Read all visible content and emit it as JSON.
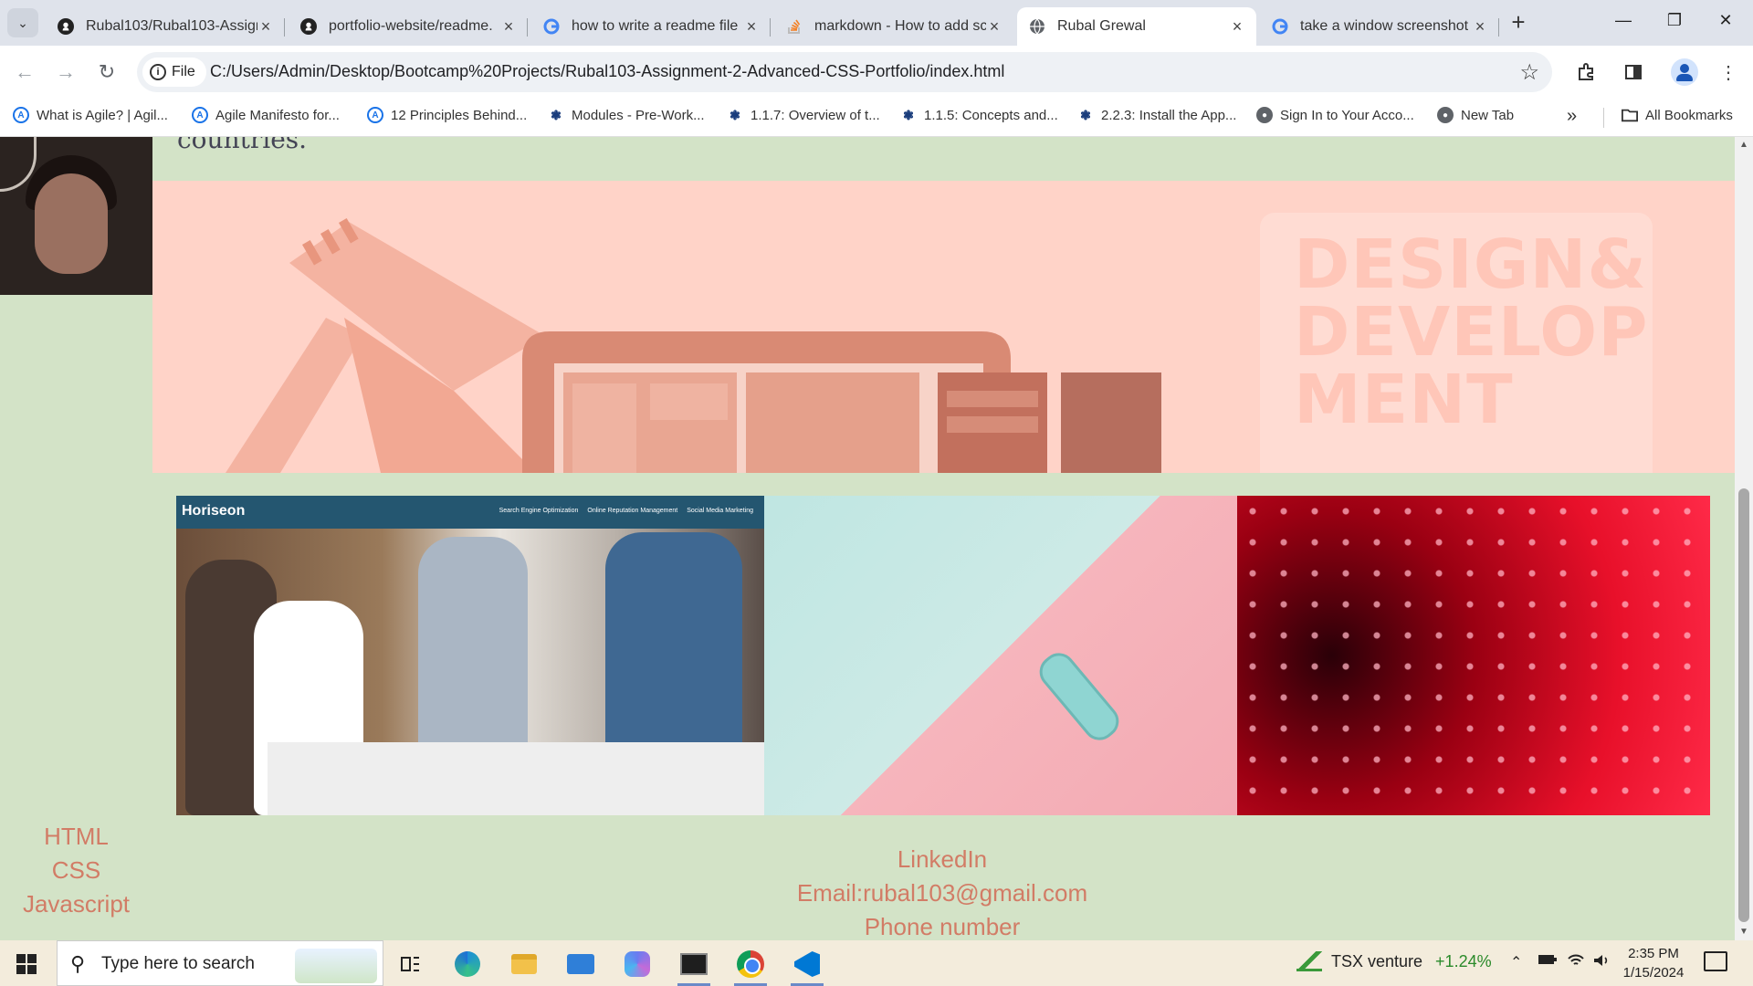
{
  "browser": {
    "tabs": [
      {
        "title": "Rubal103/Rubal103-Assign",
        "icon": "github-icon",
        "active": false
      },
      {
        "title": "portfolio-website/readme.",
        "icon": "github-icon",
        "active": false
      },
      {
        "title": "how to write a readme file",
        "icon": "google-icon",
        "active": false
      },
      {
        "title": "markdown - How to add sc",
        "icon": "stackoverflow-icon",
        "active": false
      },
      {
        "title": "Rubal Grewal",
        "icon": "globe-icon",
        "active": true
      },
      {
        "title": "take a window screenshot",
        "icon": "google-icon",
        "active": false
      }
    ],
    "address": {
      "scheme_label": "File",
      "url": "C:/Users/Admin/Desktop/Bootcamp%20Projects/Rubal103-Assignment-2-Advanced-CSS-Portfolio/index.html"
    },
    "bookmarks": [
      {
        "label": "What is Agile? | Agil...",
        "icon": "agile-icon"
      },
      {
        "label": "Agile Manifesto for...",
        "icon": "agile-icon"
      },
      {
        "label": "12 Principles Behind...",
        "icon": "agile-icon"
      },
      {
        "label": "Modules - Pre-Work...",
        "icon": "canvas-icon"
      },
      {
        "label": "1.1.7: Overview of t...",
        "icon": "canvas-icon"
      },
      {
        "label": "1.1.5: Concepts and...",
        "icon": "canvas-icon"
      },
      {
        "label": "2.2.3: Install the App...",
        "icon": "canvas-icon"
      },
      {
        "label": "Sign In to Your Acco...",
        "icon": "globe-icon"
      },
      {
        "label": "New Tab",
        "icon": "globe-icon"
      }
    ],
    "all_bookmarks_label": "All Bookmarks"
  },
  "page": {
    "intro_tail": "countries.",
    "hero_text_lines": [
      "DESIGN&",
      "DEVELOP",
      "MENT"
    ],
    "gallery": [
      {
        "brand": "Horiseon",
        "menu": [
          "Search Engine Optimization",
          "Online Reputation Management",
          "Social Media Marketing"
        ]
      }
    ],
    "skills": [
      "HTML",
      "CSS",
      "Javascript"
    ],
    "contact": [
      "LinkedIn",
      "Email:rubal103@gmail.com",
      "Phone number"
    ]
  },
  "taskbar": {
    "search_placeholder": "Type here to search",
    "ticker_name": "TSX venture",
    "ticker_change": "+1.24%",
    "time": "2:35 PM",
    "date": "1/15/2024"
  },
  "colors": {
    "page_background": "#d3e3c7",
    "hero_background": "#ffd3c8",
    "accent_text": "#d27c66"
  }
}
